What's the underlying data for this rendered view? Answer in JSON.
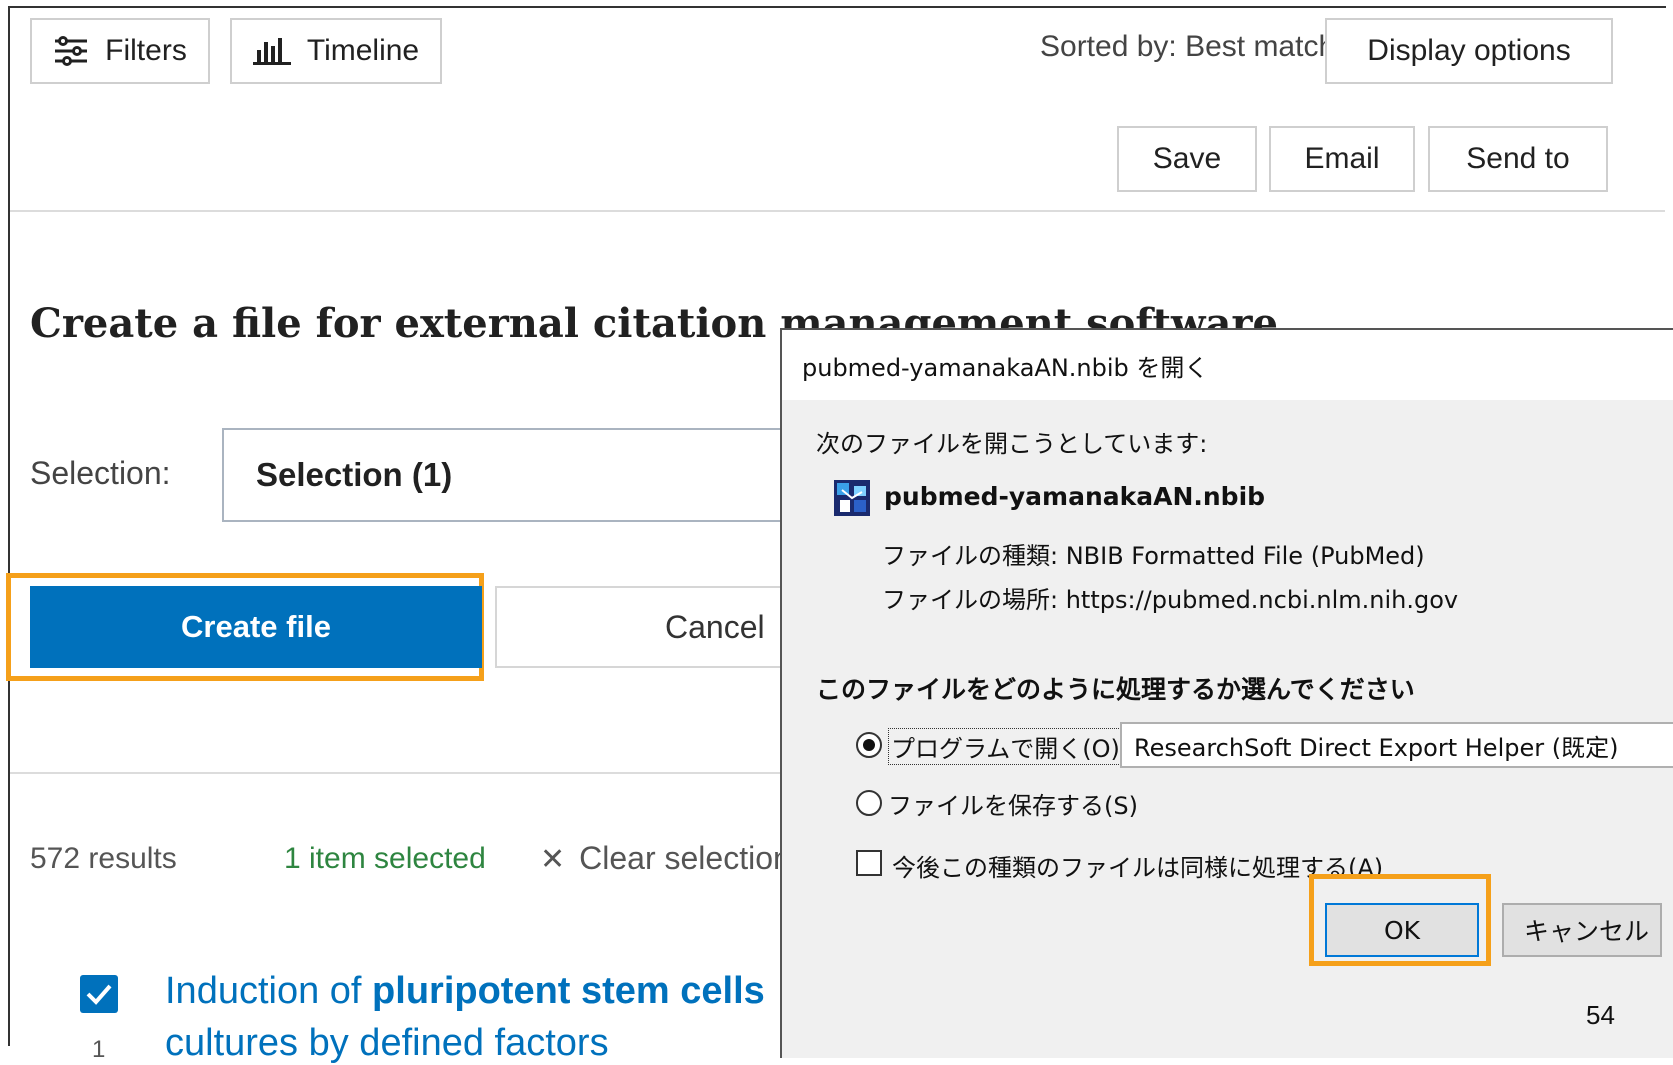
{
  "toolbar": {
    "filters_label": "Filters",
    "timeline_label": "Timeline",
    "sorted_by": "Sorted by: Best match",
    "display_options": "Display options",
    "save": "Save",
    "email": "Email",
    "send_to": "Send to"
  },
  "citation_panel": {
    "heading": "Create a file for external citation management software",
    "selection_label": "Selection:",
    "selection_value": "Selection (1)",
    "create_button": "Create file",
    "cancel_button": "Cancel"
  },
  "results": {
    "count": "572 results",
    "selected": "1 item selected",
    "clear": "Clear selection"
  },
  "article": {
    "checked": true,
    "number": "1",
    "title_prefix": "Induction of ",
    "title_bold": "pluripotent stem cells",
    "title_line2": "cultures by defined factors"
  },
  "dialog": {
    "title": "pubmed-yamanakaAN.nbib を開く",
    "prompt": "次のファイルを開こうとしています:",
    "file_name": "pubmed-yamanakaAN.nbib",
    "file_type": "ファイルの種類:  NBIB Formatted File (PubMed)",
    "file_location": "ファイルの場所:  https://pubmed.ncbi.nlm.nih.gov",
    "choose_prompt": "このファイルをどのように処理するか選んでください",
    "open_with": "プログラムで開く(O):",
    "open_with_app": "ResearchSoft Direct Export Helper (既定)",
    "save_file": "ファイルを保存する(S)",
    "remember": "今後この種類のファイルは同様に処理する(A)",
    "ok": "OK",
    "cancel": "キャンセル"
  },
  "highlight_color": "#f5a01a",
  "page_number": "54"
}
